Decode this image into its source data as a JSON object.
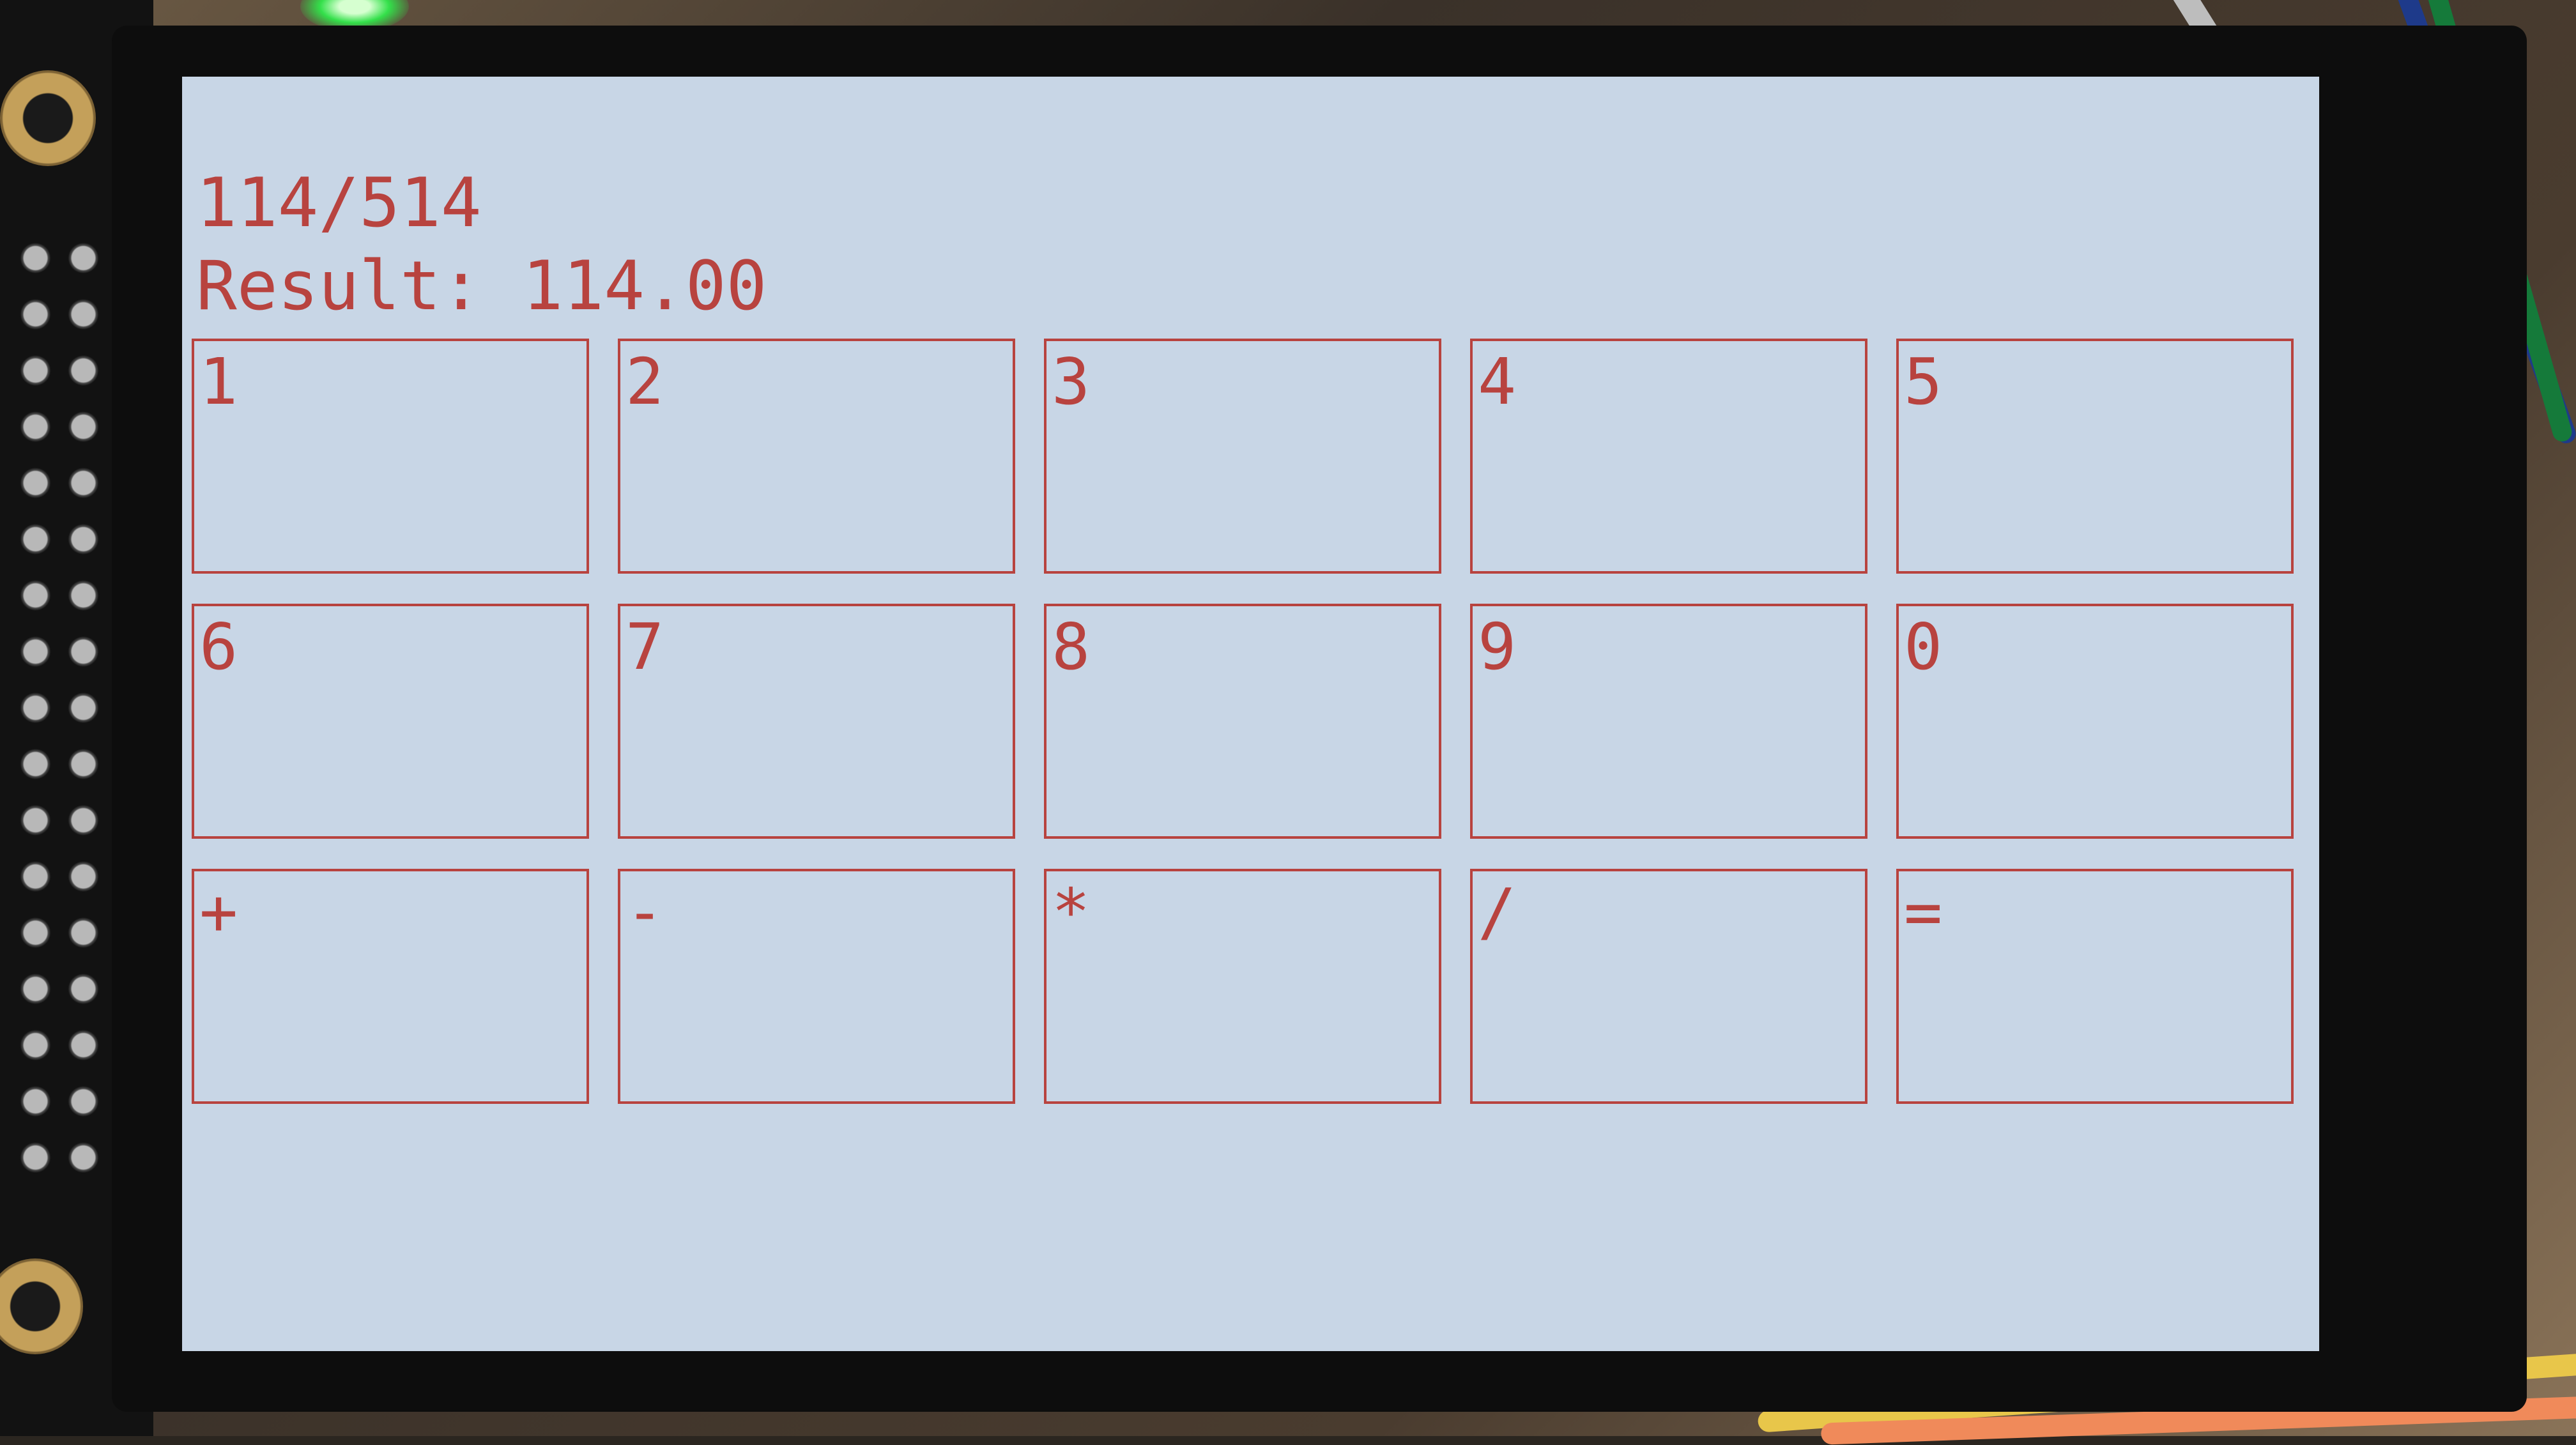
{
  "display": {
    "expression": "114/514",
    "result_label": "Result:",
    "result_value": "114.00"
  },
  "keypad": {
    "rows": [
      [
        {
          "label": "1"
        },
        {
          "label": "2"
        },
        {
          "label": "3"
        },
        {
          "label": "4"
        },
        {
          "label": "5"
        }
      ],
      [
        {
          "label": "6"
        },
        {
          "label": "7"
        },
        {
          "label": "8"
        },
        {
          "label": "9"
        },
        {
          "label": "0"
        }
      ],
      [
        {
          "label": "+"
        },
        {
          "label": "-"
        },
        {
          "label": "*"
        },
        {
          "label": "/"
        },
        {
          "label": "="
        }
      ]
    ]
  },
  "colors": {
    "text_and_outline": "#b8433f",
    "screen_background": "#c8d6e6",
    "bezel": "#0d0d0d"
  }
}
